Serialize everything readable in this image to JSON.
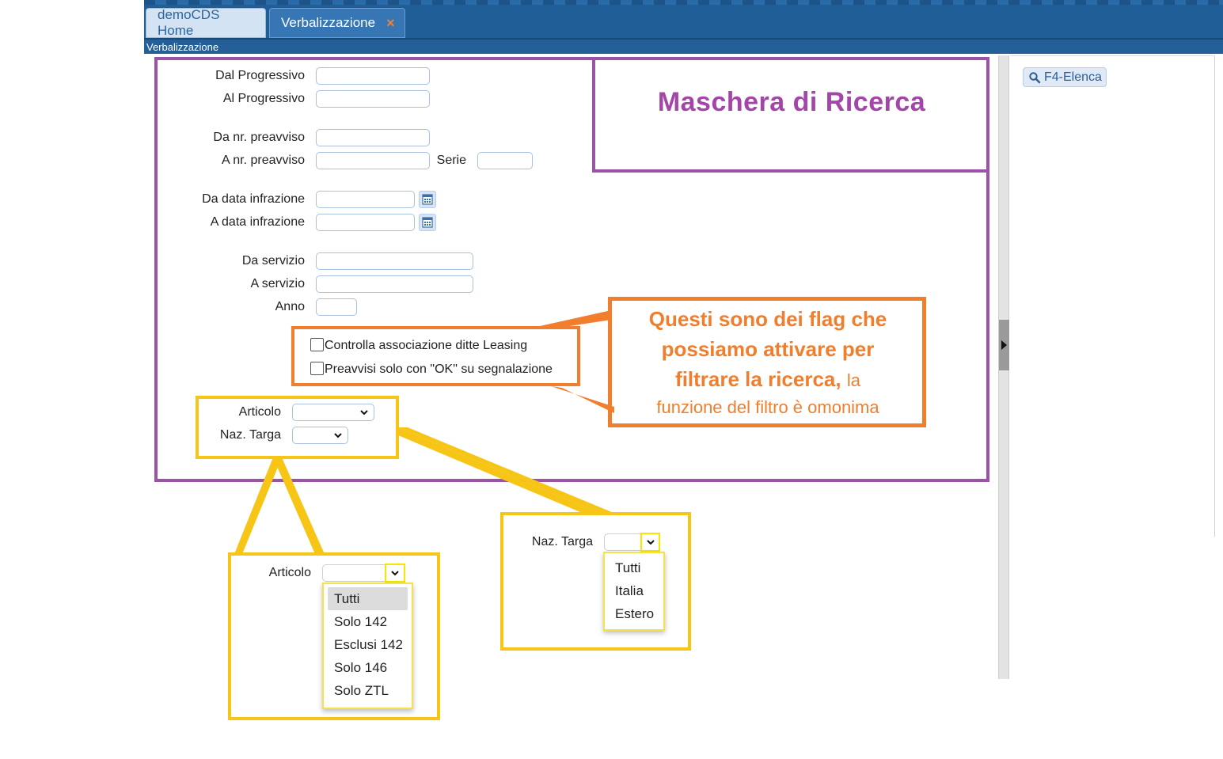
{
  "tabs": [
    {
      "label": "demoCDS Home"
    },
    {
      "label": "Verbalizzazione",
      "close": "×"
    }
  ],
  "breadcrumb": "Verbalizzazione",
  "toolbar": {
    "f4_label": "F4-Elenca"
  },
  "form": {
    "dal_progressivo": "Dal Progressivo",
    "al_progressivo": "Al Progressivo",
    "da_preavviso": "Da nr. preavviso",
    "a_preavviso": "A nr. preavviso",
    "serie": "Serie",
    "da_data": "Da data infrazione",
    "a_data": "A data infrazione",
    "da_servizio": "Da servizio",
    "a_servizio": "A servizio",
    "anno": "Anno",
    "flag_leasing": "Controlla associazione ditte Leasing",
    "flag_ok": "Preavvisi solo con \"OK\" su segnalazione",
    "articolo": "Articolo",
    "naz_targa": "Naz. Targa"
  },
  "annotations": {
    "title": "Maschera di Ricerca",
    "note_line1": "Questi sono dei flag che",
    "note_line2": "possiamo attivare per",
    "note_line3": "filtrare la ricerca,",
    "note_line3b": "la",
    "note_line4": "funzione del filtro è omonima"
  },
  "articolo_dropdown": {
    "label": "Articolo",
    "options": [
      "Tutti",
      "Solo 142",
      "Esclusi 142",
      "Solo 146",
      "Solo ZTL"
    ]
  },
  "naz_dropdown": {
    "label": "Naz. Targa",
    "options": [
      "Tutti",
      "Italia",
      "Estero"
    ]
  },
  "colors": {
    "header": "#1f5e96",
    "purple": "#9c52a6",
    "orange": "#f07e2d",
    "yellow": "#f6c516"
  }
}
